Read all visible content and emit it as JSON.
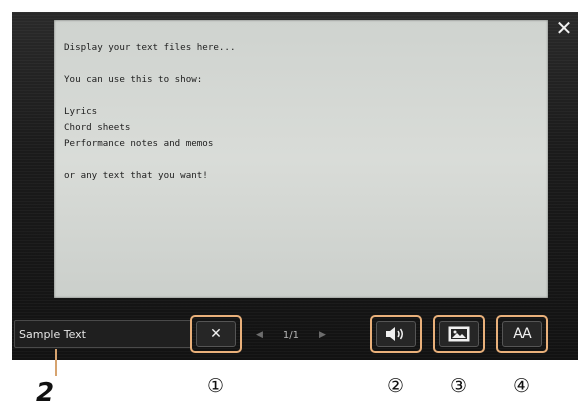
{
  "window": {
    "close_icon": "close-icon"
  },
  "text_panel": {
    "lines": [
      "Display your text files here...",
      "",
      "You can use this to show:",
      "",
      "Lyrics",
      "Chord sheets",
      "Performance notes and memos",
      "",
      "or any text that you want!"
    ]
  },
  "bottom_bar": {
    "file_name": "Sample Text",
    "clear_icon": "x-icon",
    "prev_icon": "triangle-left-icon",
    "page_counter": "1/1",
    "next_icon": "triangle-right-icon",
    "speaker_icon": "speaker-icon",
    "image_icon": "image-icon",
    "font_size_label": "AA"
  },
  "annotations": {
    "step": "2",
    "markers": [
      "①",
      "②",
      "③",
      "④"
    ],
    "highlight_color": "#e9b07a"
  }
}
